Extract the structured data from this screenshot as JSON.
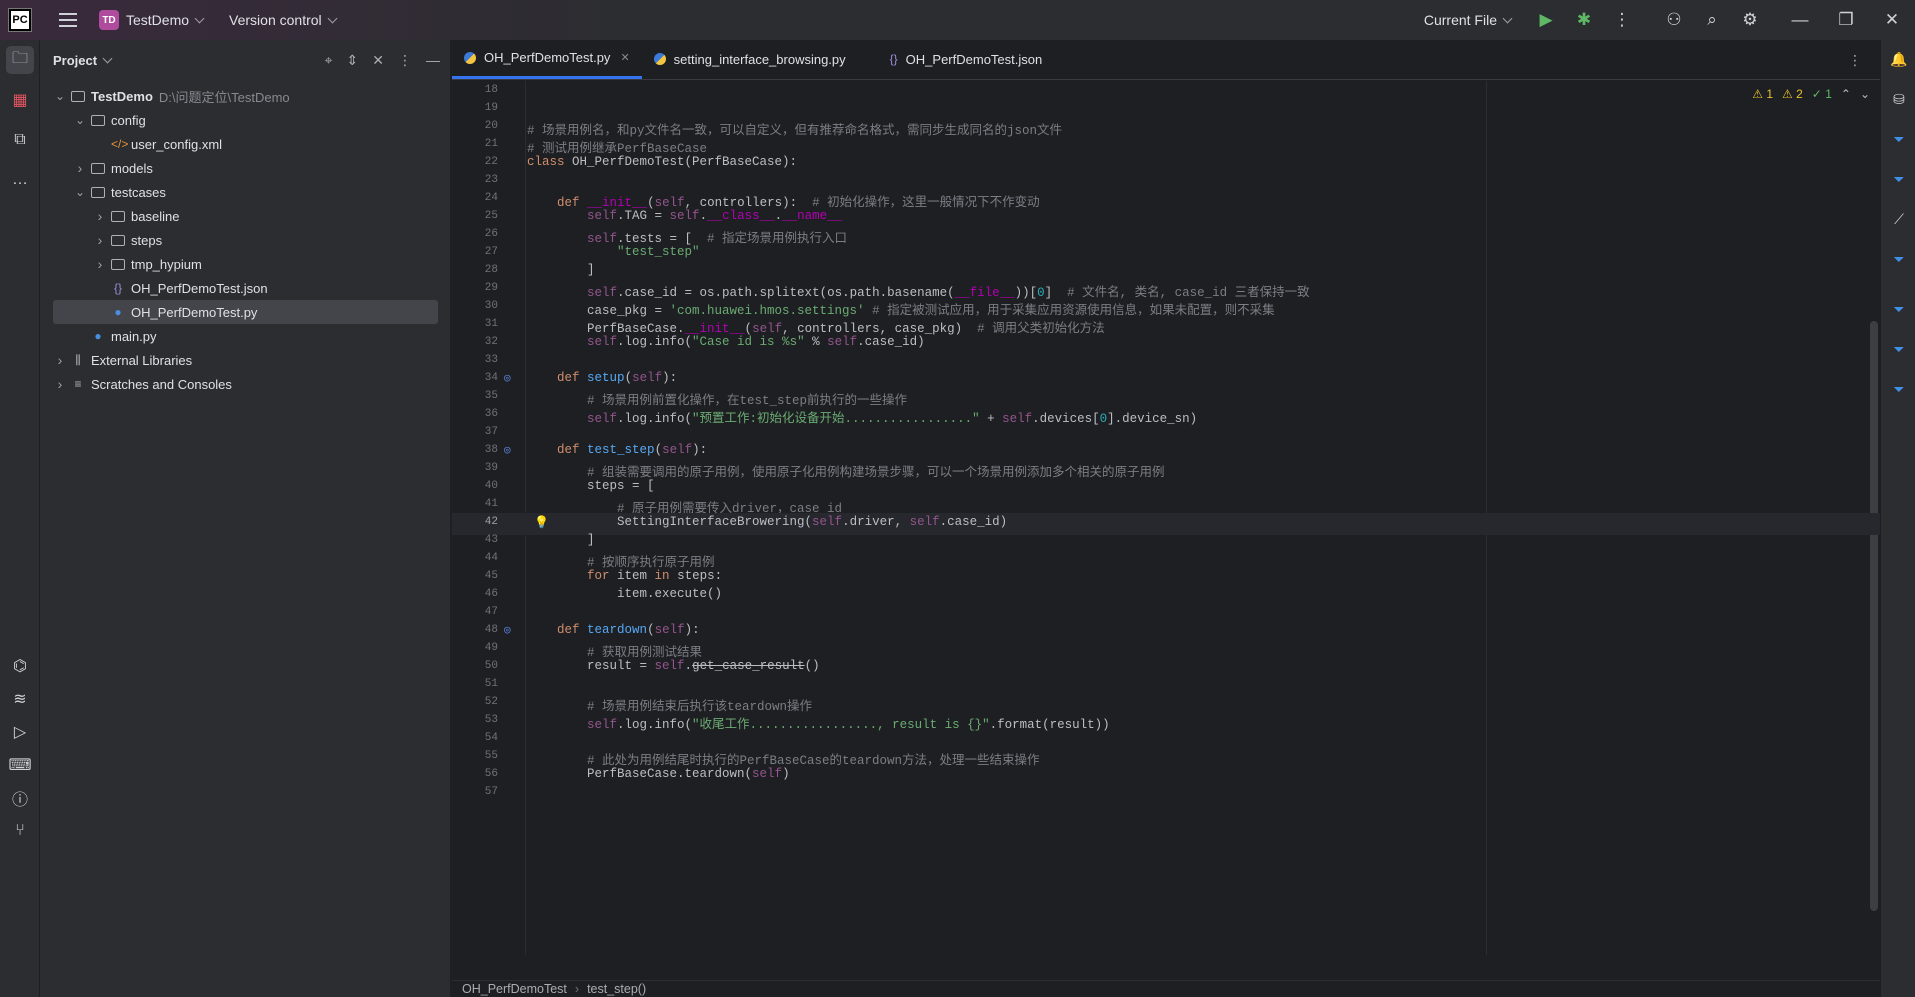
{
  "titlebar": {
    "logo": "PC",
    "project_badge": "TD",
    "project_name": "TestDemo",
    "version_control": "Version control",
    "run_config": "Current File"
  },
  "project_panel": {
    "title": "Project",
    "tree": [
      {
        "label": "TestDemo",
        "path": "D:\\问题定位\\TestDemo",
        "type": "folder",
        "expanded": true,
        "depth": 0
      },
      {
        "label": "config",
        "type": "folder",
        "expanded": true,
        "depth": 1
      },
      {
        "label": "user_config.xml",
        "type": "xml",
        "depth": 2
      },
      {
        "label": "models",
        "type": "folder",
        "expanded": false,
        "depth": 1
      },
      {
        "label": "testcases",
        "type": "folder",
        "expanded": true,
        "depth": 1
      },
      {
        "label": "baseline",
        "type": "folder",
        "expanded": false,
        "depth": 2
      },
      {
        "label": "steps",
        "type": "folder",
        "expanded": false,
        "depth": 2
      },
      {
        "label": "tmp_hypium",
        "type": "folder",
        "expanded": false,
        "depth": 2
      },
      {
        "label": "OH_PerfDemoTest.json",
        "type": "json",
        "depth": 2
      },
      {
        "label": "OH_PerfDemoTest.py",
        "type": "py",
        "depth": 2,
        "selected": true
      },
      {
        "label": "main.py",
        "type": "py",
        "depth": 1
      },
      {
        "label": "External Libraries",
        "type": "lib",
        "expanded": false,
        "depth": 0
      },
      {
        "label": "Scratches and Consoles",
        "type": "scratch",
        "expanded": false,
        "depth": 0
      }
    ]
  },
  "editor": {
    "tabs": [
      {
        "label": "OH_PerfDemoTest.py",
        "icon": "python-icon",
        "active": true
      },
      {
        "label": "setting_interface_browsing.py",
        "icon": "python-icon",
        "active": false
      },
      {
        "label": "OH_PerfDemoTest.json",
        "icon": "json-icon",
        "active": false
      }
    ],
    "inspections": {
      "warnings": "1",
      "weak_warnings": "2",
      "ok": "1"
    },
    "current_line": 42,
    "lines": [
      {
        "n": "18",
        "code": ""
      },
      {
        "n": "19",
        "code": ""
      },
      {
        "n": "20",
        "code": "# 场景用例名，和py文件名一致，可以自定义，但有推荐命名格式，需同步生成同名的json文件"
      },
      {
        "n": "21",
        "code": "# 测试用例继承PerfBaseCase"
      },
      {
        "n": "22",
        "code": "class OH_PerfDemoTest(PerfBaseCase):"
      },
      {
        "n": "23",
        "code": ""
      },
      {
        "n": "24",
        "code": "    def __init__(self, controllers):  # 初始化操作，这里一般情况下不作变动"
      },
      {
        "n": "25",
        "code": "        self.TAG = self.__class__.__name__"
      },
      {
        "n": "26",
        "code": "        self.tests = [  # 指定场景用例执行入口"
      },
      {
        "n": "27",
        "code": "            \"test_step\""
      },
      {
        "n": "28",
        "code": "        ]"
      },
      {
        "n": "29",
        "code": "        self.case_id = os.path.splitext(os.path.basename(__file__))[0]  # 文件名, 类名, case_id 三者保持一致"
      },
      {
        "n": "30",
        "code": "        case_pkg = 'com.huawei.hmos.settings' # 指定被测试应用，用于采集应用资源使用信息，如果未配置，则不采集"
      },
      {
        "n": "31",
        "code": "        PerfBaseCase.__init__(self, controllers, case_pkg)  # 调用父类初始化方法"
      },
      {
        "n": "32",
        "code": "        self.log.info(\"Case id is %s\" % self.case_id)"
      },
      {
        "n": "33",
        "code": ""
      },
      {
        "n": "34",
        "code": "    def setup(self):"
      },
      {
        "n": "35",
        "code": "        # 场景用例前置化操作，在test_step前执行的一些操作"
      },
      {
        "n": "36",
        "code": "        self.log.info(\"预置工作:初始化设备开始.................\" + self.devices[0].device_sn)"
      },
      {
        "n": "37",
        "code": ""
      },
      {
        "n": "38",
        "code": "    def test_step(self):"
      },
      {
        "n": "39",
        "code": "        # 组装需要调用的原子用例，使用原子化用例构建场景步骤，可以一个场景用例添加多个相关的原子用例"
      },
      {
        "n": "40",
        "code": "        steps = ["
      },
      {
        "n": "41",
        "code": "            # 原子用例需要传入driver，case_id"
      },
      {
        "n": "42",
        "code": "            SettingInterfaceBrowering(self.driver, self.case_id)"
      },
      {
        "n": "43",
        "code": "        ]"
      },
      {
        "n": "44",
        "code": "        # 按顺序执行原子用例"
      },
      {
        "n": "45",
        "code": "        for item in steps:"
      },
      {
        "n": "46",
        "code": "            item.execute()"
      },
      {
        "n": "47",
        "code": ""
      },
      {
        "n": "48",
        "code": "    def teardown(self):"
      },
      {
        "n": "49",
        "code": "        # 获取用例测试结果"
      },
      {
        "n": "50",
        "code": "        result = self.get_case_result()"
      },
      {
        "n": "51",
        "code": ""
      },
      {
        "n": "52",
        "code": "        # 场景用例结束后执行该teardown操作"
      },
      {
        "n": "53",
        "code": "        self.log.info(\"收尾工作................., result is {}\".format(result))"
      },
      {
        "n": "54",
        "code": ""
      },
      {
        "n": "55",
        "code": "        # 此处为用例结尾时执行的PerfBaseCase的teardown方法，处理一些结束操作"
      },
      {
        "n": "56",
        "code": "        PerfBaseCase.teardown(self)"
      },
      {
        "n": "57",
        "code": ""
      }
    ],
    "breadcrumb": [
      "OH_PerfDemoTest",
      "test_step()"
    ]
  }
}
